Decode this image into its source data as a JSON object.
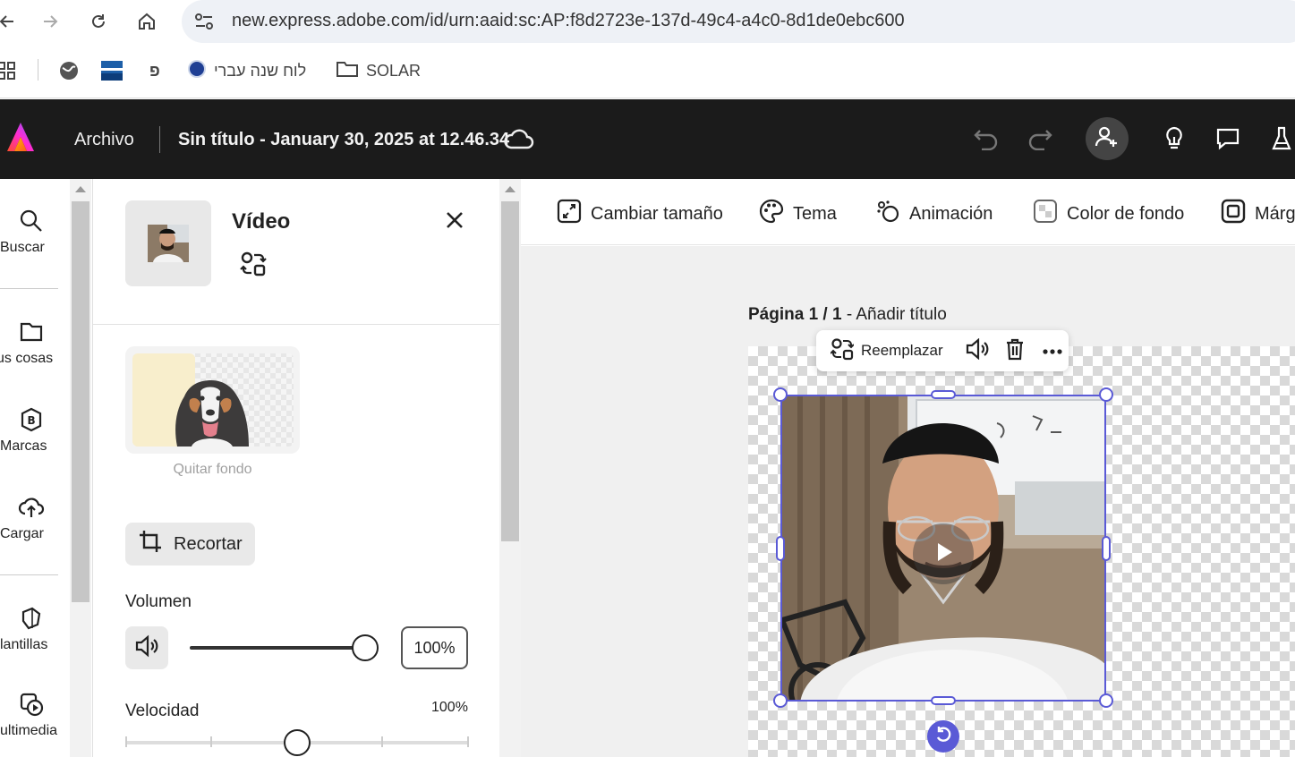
{
  "browser": {
    "url": "new.express.adobe.com/id/urn:aaid:sc:AP:f8d2723e-137d-49c4-a4c0-8d1de0ebc600",
    "bookmarks": [
      {
        "label": "פ"
      },
      {
        "label": "לוח שנה עברי"
      },
      {
        "label": "SOLAR"
      }
    ]
  },
  "appbar": {
    "file_menu": "Archivo",
    "doc_title": "Sin título - January 30, 2025 at 12.46.34"
  },
  "rail": {
    "items": [
      {
        "label": "Buscar"
      },
      {
        "label": "us cosas"
      },
      {
        "label": "Marcas"
      },
      {
        "label": "Cargar"
      },
      {
        "label": "lantillas"
      },
      {
        "label": "ultimedia"
      }
    ]
  },
  "panel": {
    "title": "Vídeo",
    "remove_bg_label": "Quitar fondo",
    "crop_label": "Recortar",
    "volume_label": "Volumen",
    "volume_value": "100%",
    "volume_level": 1.0,
    "speed_label": "Velocidad",
    "speed_value": "100%",
    "speed_level": 0.5
  },
  "toolbar": {
    "items": [
      {
        "label": "Cambiar tamaño"
      },
      {
        "label": "Tema"
      },
      {
        "label": "Animación"
      },
      {
        "label": "Color de fondo"
      },
      {
        "label": "Márg"
      }
    ]
  },
  "canvas": {
    "page_prefix": "Página 1 / 1",
    "page_title_action": " - Añadir título",
    "replace_label": "Reemplazar"
  },
  "colors": {
    "selection": "#5a5ad6",
    "appbar_bg": "#1b1b1b"
  }
}
